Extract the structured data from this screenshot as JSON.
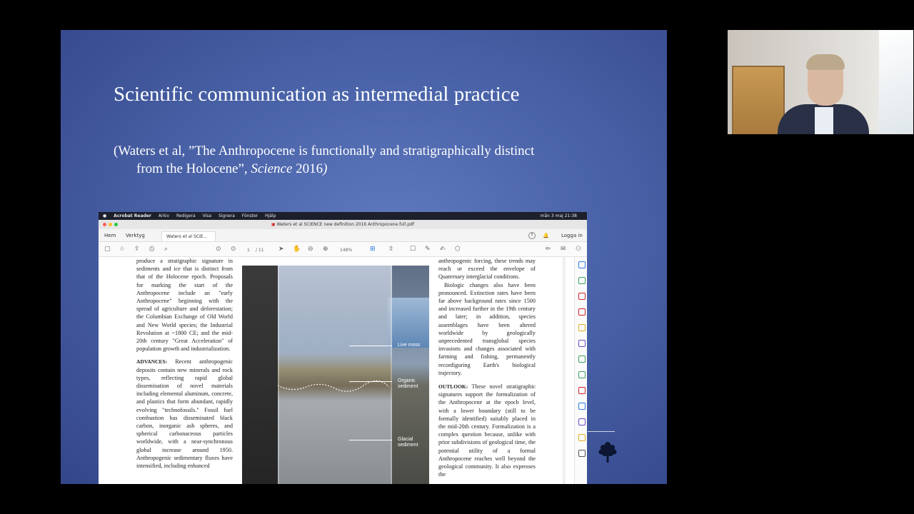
{
  "slide": {
    "title": "Scientific communication as intermedial practice",
    "citation_line1": "(Waters et al, ”The Anthropocene is functionally and stratigraphically distinct",
    "citation_line2_pre": "from the Holocene”, ",
    "citation_journal": "Science",
    "citation_year": " 2016",
    "citation_close": ")"
  },
  "mac_menubar": {
    "apple": "",
    "app": "Acrobat Reader",
    "items": [
      "Arkiv",
      "Redigera",
      "Visa",
      "Signera",
      "Fönster",
      "Hjälp"
    ],
    "clock": "mån 3 maj  21:38"
  },
  "acrobat": {
    "window_title": "Waters et al SCIENCE new definition 2016 Anthropocene.full.pdf",
    "nav_home": "Hem",
    "nav_tools": "Verktyg",
    "doc_tab": "Waters et al SCIE...",
    "doc_tab_close": "×",
    "help": "?",
    "login": "Logga in",
    "page_current": "1",
    "page_total": "/ 11",
    "zoom": "148%"
  },
  "article": {
    "left_p1": "produce a stratigraphic signature in sediments and ice that is distinct from that of the Holocene epoch. Proposals for marking the start of the Anthropocene include an \"early Anthropocene\" beginning with the spread of agriculture and deforestation; the Columbian Exchange of Old World and New World species; the Industrial Revolution at ~1800 CE; and the mid-20th century \"Great Acceleration\" of population growth and industrialization.",
    "left_h2": "ADVANCES:",
    "left_p2": " Recent anthropogenic deposits contain new minerals and rock types, reflecting rapid global dissemination of novel materials including elemental aluminum, concrete, and plastics that form abundant, rapidly evolving \"technofossils.\" Fossil fuel combustion has disseminated black carbon, inorganic ash spheres, and spherical carbonaceous particles worldwide, with a near-synchronous global increase around 1950. Anthropogenic sedimentary fluxes have intensified, including enhanced",
    "right_p1": "anthropogenic forcing, these trends may reach or exceed the envelope of Quaternary interglacial conditions.",
    "right_p2": "Biologic changes also have been pronounced. Extinction rates have been far above background rates since 1500 and increased further in the 19th century and later; in addition, species assemblages have been altered worldwide by geologically unprecedented transglobal species invasions and changes associated with farming and fishing, permanently reconfiguring Earth's biological trajectory.",
    "right_h2": "OUTLOOK:",
    "right_p3": " These novel stratigraphic signatures support the formalization of the Anthropocene at the epoch level, with a lower boundary (still to be formally identified) suitably placed in the mid-20th century. Formalization is a complex question because, unlike with prior subdivisions of geological time, the potential utility of a formal Anthropocene reaches well beyond the geological community. It also expresses the"
  },
  "figure": {
    "label_live_moss": "Live moss",
    "label_organic": "Organic sediment",
    "label_glacial": "Glacial sediment"
  },
  "colors": {
    "slide_blue": "#4a63a8",
    "acrobat_red": "#d2232a",
    "right_panel_icons": [
      "#2d7be0",
      "#3aa05a",
      "#d2232a",
      "#d2232a",
      "#e0b020",
      "#6a4bc4",
      "#3aa05a",
      "#3aa05a",
      "#d2232a",
      "#2d7be0",
      "#6a4bc4",
      "#e0b020",
      "#555555"
    ]
  },
  "icons": [
    "apple-icon",
    "save-icon",
    "star-icon",
    "upload-icon",
    "print-icon",
    "zoom-icon",
    "hand-icon",
    "pen-icon",
    "sign-icon",
    "tree-logo"
  ]
}
